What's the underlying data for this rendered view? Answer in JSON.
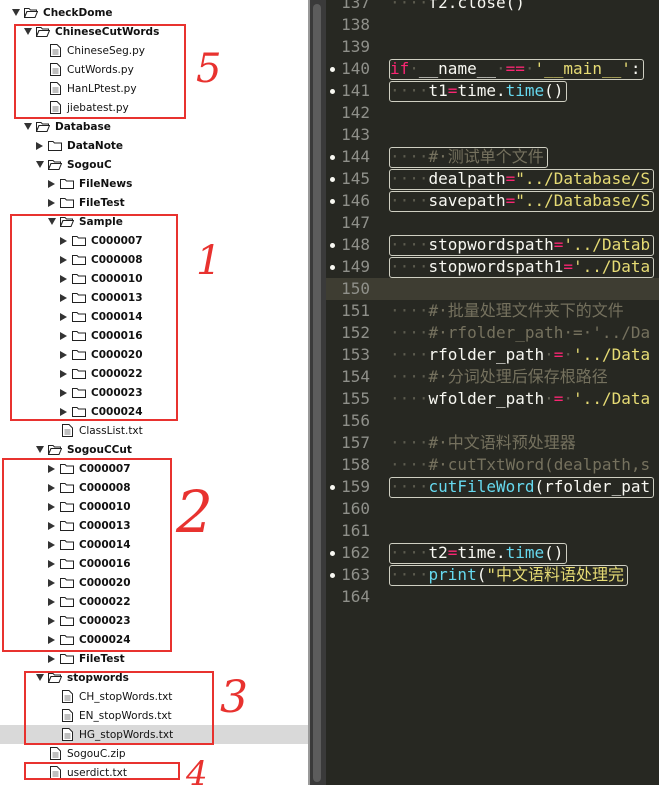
{
  "tree": [
    {
      "name": "CheckDome",
      "type": "folder",
      "depth": 0,
      "open": true
    },
    {
      "name": "ChineseCutWords",
      "type": "folder",
      "depth": 1,
      "open": true
    },
    {
      "name": "ChineseSeg.py",
      "type": "file",
      "depth": 2
    },
    {
      "name": "CutWords.py",
      "type": "file",
      "depth": 2
    },
    {
      "name": "HanLPtest.py",
      "type": "file",
      "depth": 2
    },
    {
      "name": "jiebatest.py",
      "type": "file",
      "depth": 2
    },
    {
      "name": "Database",
      "type": "folder",
      "depth": 1,
      "open": true
    },
    {
      "name": "DataNote",
      "type": "folder",
      "depth": 2,
      "open": false
    },
    {
      "name": "SogouC",
      "type": "folder",
      "depth": 2,
      "open": true
    },
    {
      "name": "FileNews",
      "type": "folder",
      "depth": 3,
      "open": false
    },
    {
      "name": "FileTest",
      "type": "folder",
      "depth": 3,
      "open": false
    },
    {
      "name": "Sample",
      "type": "folder",
      "depth": 3,
      "open": true
    },
    {
      "name": "C000007",
      "type": "folder",
      "depth": 4,
      "open": false
    },
    {
      "name": "C000008",
      "type": "folder",
      "depth": 4,
      "open": false
    },
    {
      "name": "C000010",
      "type": "folder",
      "depth": 4,
      "open": false
    },
    {
      "name": "C000013",
      "type": "folder",
      "depth": 4,
      "open": false
    },
    {
      "name": "C000014",
      "type": "folder",
      "depth": 4,
      "open": false
    },
    {
      "name": "C000016",
      "type": "folder",
      "depth": 4,
      "open": false
    },
    {
      "name": "C000020",
      "type": "folder",
      "depth": 4,
      "open": false
    },
    {
      "name": "C000022",
      "type": "folder",
      "depth": 4,
      "open": false
    },
    {
      "name": "C000023",
      "type": "folder",
      "depth": 4,
      "open": false
    },
    {
      "name": "C000024",
      "type": "folder",
      "depth": 4,
      "open": false
    },
    {
      "name": "ClassList.txt",
      "type": "file",
      "depth": 3
    },
    {
      "name": "SogouCCut",
      "type": "folder",
      "depth": 2,
      "open": true
    },
    {
      "name": "C000007",
      "type": "folder",
      "depth": 3,
      "open": false
    },
    {
      "name": "C000008",
      "type": "folder",
      "depth": 3,
      "open": false
    },
    {
      "name": "C000010",
      "type": "folder",
      "depth": 3,
      "open": false
    },
    {
      "name": "C000013",
      "type": "folder",
      "depth": 3,
      "open": false
    },
    {
      "name": "C000014",
      "type": "folder",
      "depth": 3,
      "open": false
    },
    {
      "name": "C000016",
      "type": "folder",
      "depth": 3,
      "open": false
    },
    {
      "name": "C000020",
      "type": "folder",
      "depth": 3,
      "open": false
    },
    {
      "name": "C000022",
      "type": "folder",
      "depth": 3,
      "open": false
    },
    {
      "name": "C000023",
      "type": "folder",
      "depth": 3,
      "open": false
    },
    {
      "name": "C000024",
      "type": "folder",
      "depth": 3,
      "open": false
    },
    {
      "name": "FileTest",
      "type": "folder",
      "depth": 3,
      "open": false
    },
    {
      "name": "stopwords",
      "type": "folder",
      "depth": 2,
      "open": true
    },
    {
      "name": "CH_stopWords.txt",
      "type": "file",
      "depth": 3
    },
    {
      "name": "EN_stopWords.txt",
      "type": "file",
      "depth": 3
    },
    {
      "name": "HG_stopWords.txt",
      "type": "file",
      "depth": 3,
      "selected": true
    },
    {
      "name": "SogouC.zip",
      "type": "file",
      "depth": 2
    },
    {
      "name": "userdict.txt",
      "type": "file",
      "depth": 2
    }
  ],
  "annotations": [
    "5",
    "1",
    "2",
    "3",
    "4"
  ],
  "colors": {
    "annotation": "#e8322f",
    "editor_bg": "#272822",
    "keyword": "#f92672",
    "string": "#e6db74",
    "function": "#66d9ef",
    "comment": "#75715e",
    "text": "#f8f8f2",
    "line_number": "#8f908a"
  },
  "editor": {
    "lines": [
      {
        "num": "137",
        "marker": false,
        "box": false,
        "tokens": [
          {
            "t": "····",
            "c": "ws"
          },
          {
            "t": "f2.close()",
            "c": "text"
          }
        ]
      },
      {
        "num": "138",
        "marker": false,
        "box": false,
        "tokens": []
      },
      {
        "num": "139",
        "marker": false,
        "box": false,
        "tokens": []
      },
      {
        "num": "140",
        "marker": true,
        "box": true,
        "tokens": [
          {
            "t": "if",
            "c": "keyword"
          },
          {
            "t": "·",
            "c": "ws"
          },
          {
            "t": "__name__",
            "c": "text"
          },
          {
            "t": "·",
            "c": "ws"
          },
          {
            "t": "==",
            "c": "keyword"
          },
          {
            "t": "·",
            "c": "ws"
          },
          {
            "t": "'__main__'",
            "c": "string"
          },
          {
            "t": ":",
            "c": "text"
          }
        ]
      },
      {
        "num": "141",
        "marker": true,
        "box": true,
        "tokens": [
          {
            "t": "····",
            "c": "ws"
          },
          {
            "t": "t1",
            "c": "text"
          },
          {
            "t": "=",
            "c": "keyword"
          },
          {
            "t": "time.",
            "c": "text"
          },
          {
            "t": "time",
            "c": "function"
          },
          {
            "t": "()",
            "c": "text"
          }
        ]
      },
      {
        "num": "142",
        "marker": false,
        "box": false,
        "tokens": []
      },
      {
        "num": "143",
        "marker": false,
        "box": false,
        "tokens": []
      },
      {
        "num": "144",
        "marker": true,
        "box": true,
        "tokens": [
          {
            "t": "····",
            "c": "ws"
          },
          {
            "t": "#·测试单个文件",
            "c": "comment"
          }
        ]
      },
      {
        "num": "145",
        "marker": true,
        "box": true,
        "tokens": [
          {
            "t": "····",
            "c": "ws"
          },
          {
            "t": "dealpath",
            "c": "text"
          },
          {
            "t": "=",
            "c": "keyword"
          },
          {
            "t": "\"../Database/S",
            "c": "string"
          }
        ]
      },
      {
        "num": "146",
        "marker": true,
        "box": true,
        "tokens": [
          {
            "t": "····",
            "c": "ws"
          },
          {
            "t": "savepath",
            "c": "text"
          },
          {
            "t": "=",
            "c": "keyword"
          },
          {
            "t": "\"../Database/S",
            "c": "string"
          }
        ]
      },
      {
        "num": "147",
        "marker": false,
        "box": false,
        "tokens": []
      },
      {
        "num": "148",
        "marker": true,
        "box": true,
        "tokens": [
          {
            "t": "····",
            "c": "ws"
          },
          {
            "t": "stopwordspath",
            "c": "text"
          },
          {
            "t": "=",
            "c": "keyword"
          },
          {
            "t": "'../Datab",
            "c": "string"
          }
        ]
      },
      {
        "num": "149",
        "marker": true,
        "box": true,
        "tokens": [
          {
            "t": "····",
            "c": "ws"
          },
          {
            "t": "stopwordspath1",
            "c": "text"
          },
          {
            "t": "=",
            "c": "keyword"
          },
          {
            "t": "'../Data",
            "c": "string"
          }
        ]
      },
      {
        "num": "150",
        "marker": false,
        "box": false,
        "current": true,
        "tokens": []
      },
      {
        "num": "151",
        "marker": false,
        "box": false,
        "tokens": [
          {
            "t": "····",
            "c": "ws"
          },
          {
            "t": "#·批量处理文件夹下的文件",
            "c": "comment"
          }
        ]
      },
      {
        "num": "152",
        "marker": false,
        "box": false,
        "tokens": [
          {
            "t": "····",
            "c": "ws"
          },
          {
            "t": "#·rfolder_path·=·'../Da",
            "c": "comment"
          }
        ]
      },
      {
        "num": "153",
        "marker": false,
        "box": false,
        "tokens": [
          {
            "t": "····",
            "c": "ws"
          },
          {
            "t": "rfolder_path",
            "c": "text"
          },
          {
            "t": "·",
            "c": "ws"
          },
          {
            "t": "=",
            "c": "keyword"
          },
          {
            "t": "·",
            "c": "ws"
          },
          {
            "t": "'../Data",
            "c": "string"
          }
        ]
      },
      {
        "num": "154",
        "marker": false,
        "box": false,
        "tokens": [
          {
            "t": "····",
            "c": "ws"
          },
          {
            "t": "#·分词处理后保存根路径",
            "c": "comment"
          }
        ]
      },
      {
        "num": "155",
        "marker": false,
        "box": false,
        "tokens": [
          {
            "t": "····",
            "c": "ws"
          },
          {
            "t": "wfolder_path",
            "c": "text"
          },
          {
            "t": "·",
            "c": "ws"
          },
          {
            "t": "=",
            "c": "keyword"
          },
          {
            "t": "·",
            "c": "ws"
          },
          {
            "t": "'../Data",
            "c": "string"
          }
        ]
      },
      {
        "num": "156",
        "marker": false,
        "box": false,
        "tokens": []
      },
      {
        "num": "157",
        "marker": false,
        "box": false,
        "tokens": [
          {
            "t": "····",
            "c": "ws"
          },
          {
            "t": "#·中文语料预处理器",
            "c": "comment"
          }
        ]
      },
      {
        "num": "158",
        "marker": false,
        "box": false,
        "tokens": [
          {
            "t": "····",
            "c": "ws"
          },
          {
            "t": "#·cutTxtWord(dealpath,s",
            "c": "comment"
          }
        ]
      },
      {
        "num": "159",
        "marker": true,
        "box": true,
        "tokens": [
          {
            "t": "····",
            "c": "ws"
          },
          {
            "t": "cutFileWord",
            "c": "function"
          },
          {
            "t": "(rfolder_pat",
            "c": "text"
          }
        ]
      },
      {
        "num": "160",
        "marker": false,
        "box": false,
        "tokens": []
      },
      {
        "num": "161",
        "marker": false,
        "box": false,
        "tokens": []
      },
      {
        "num": "162",
        "marker": true,
        "box": true,
        "tokens": [
          {
            "t": "····",
            "c": "ws"
          },
          {
            "t": "t2",
            "c": "text"
          },
          {
            "t": "=",
            "c": "keyword"
          },
          {
            "t": "time.",
            "c": "text"
          },
          {
            "t": "time",
            "c": "function"
          },
          {
            "t": "()",
            "c": "text"
          }
        ]
      },
      {
        "num": "163",
        "marker": true,
        "box": true,
        "tokens": [
          {
            "t": "····",
            "c": "ws"
          },
          {
            "t": "print",
            "c": "function"
          },
          {
            "t": "(",
            "c": "text"
          },
          {
            "t": "\"中文语料语处理完",
            "c": "string"
          }
        ]
      },
      {
        "num": "164",
        "marker": false,
        "box": false,
        "tokens": []
      }
    ]
  }
}
